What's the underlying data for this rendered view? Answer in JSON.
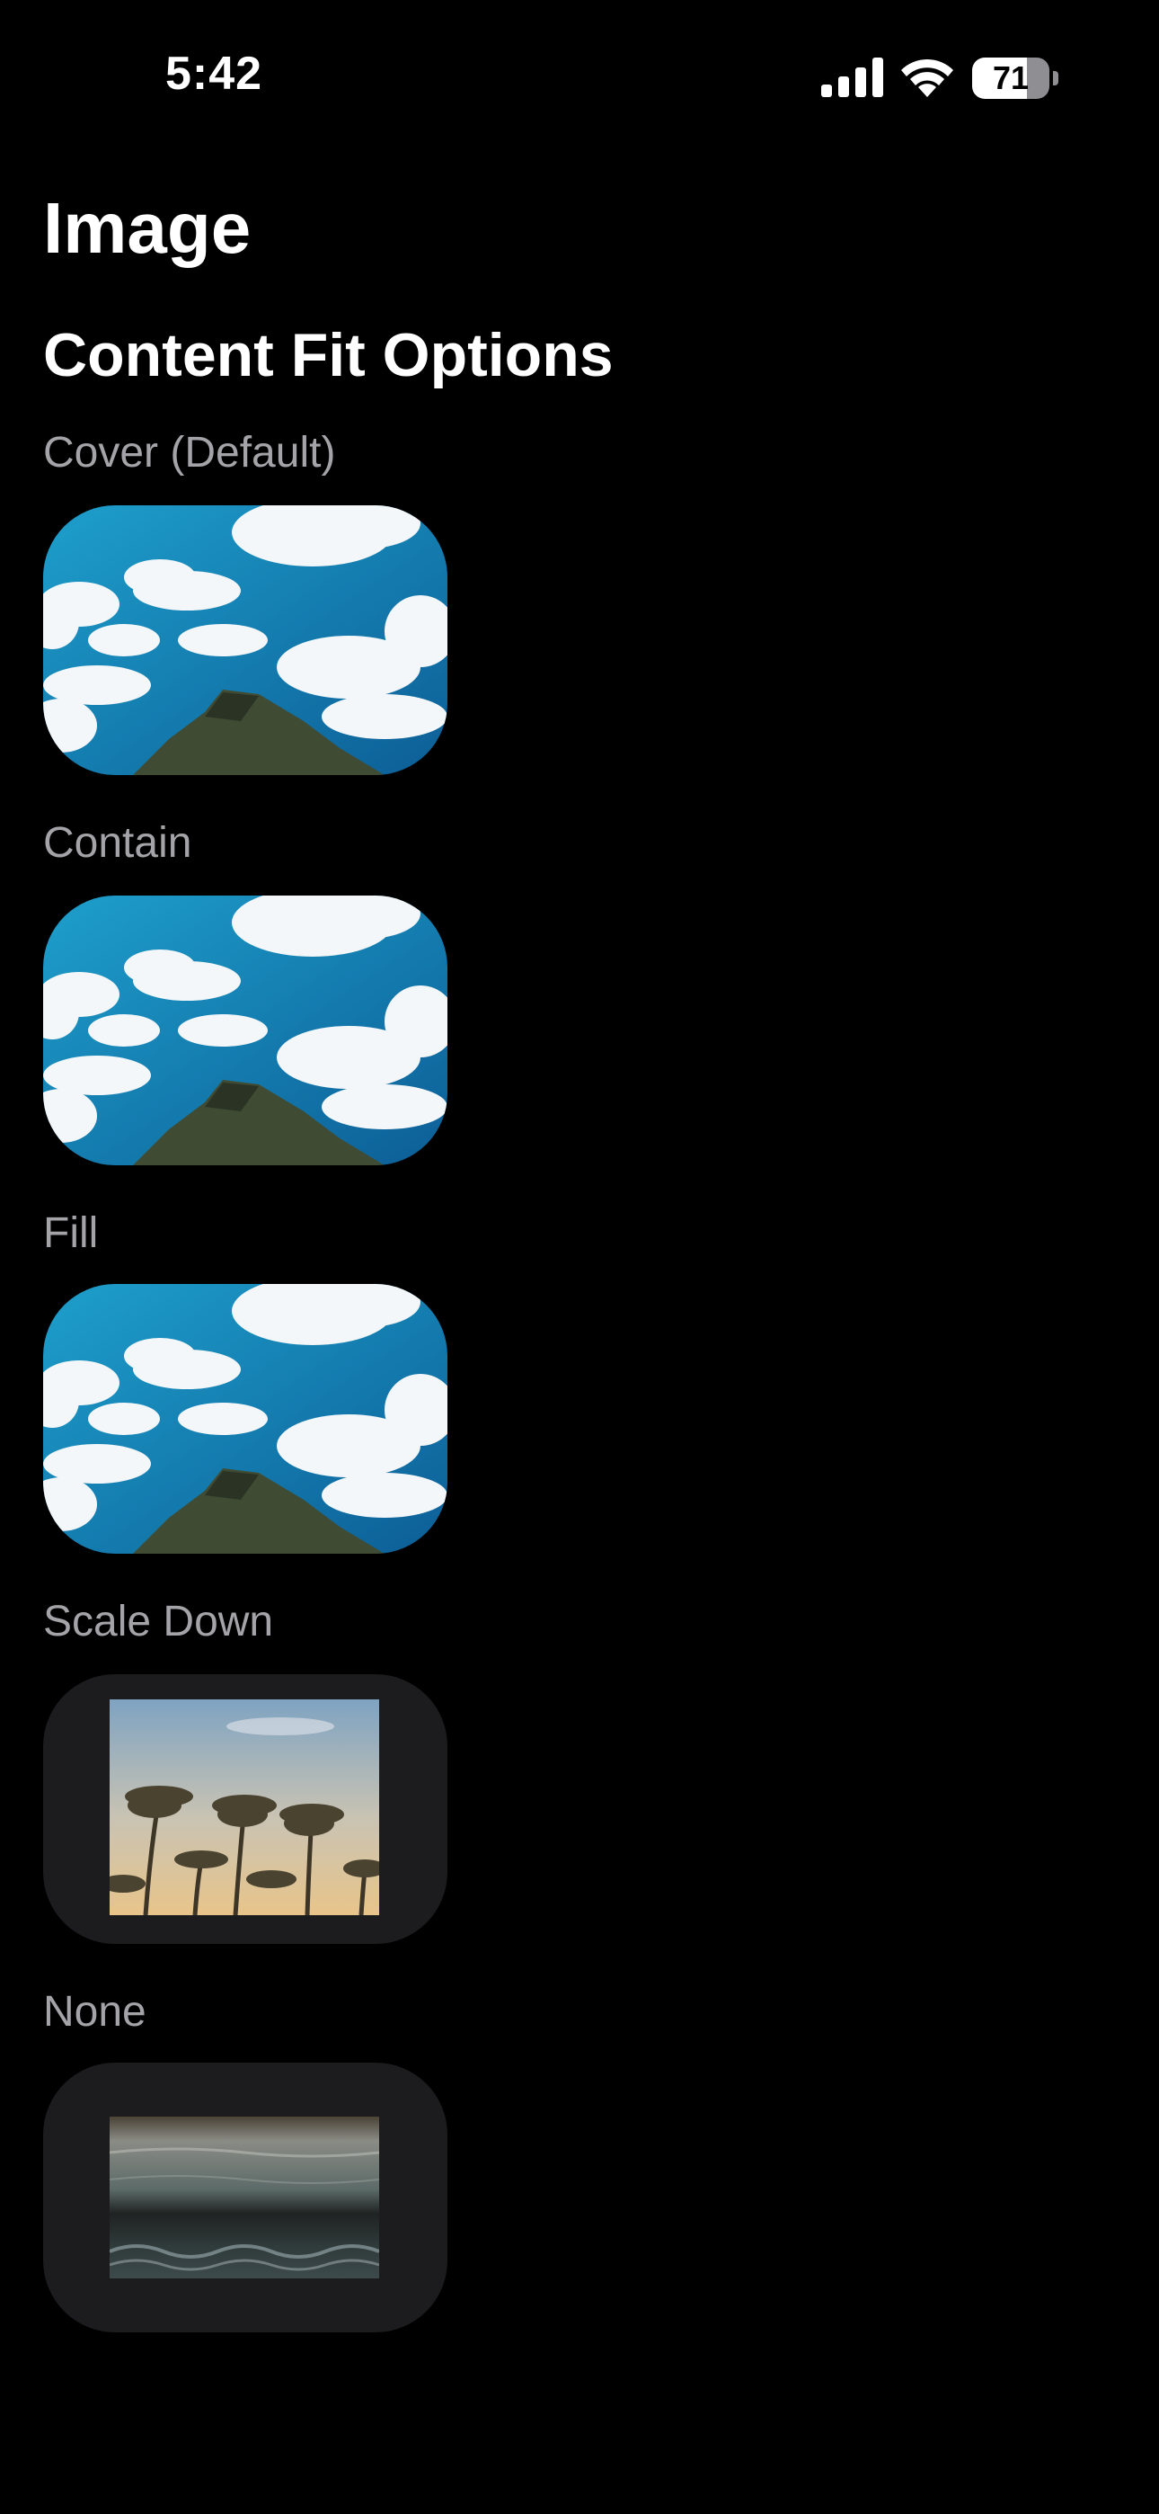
{
  "status_bar": {
    "time": "5:42",
    "battery_level": "71",
    "battery_percent": 71,
    "icons": [
      "signal-icon",
      "wifi-icon",
      "battery-icon"
    ]
  },
  "header": {
    "title": "Image"
  },
  "section": {
    "title": "Content Fit Options",
    "options": [
      {
        "label": "Cover (Default)",
        "image": "cloudy-sky-mountain-peak"
      },
      {
        "label": "Contain",
        "image": "cloudy-sky-mountain-peak"
      },
      {
        "label": "Fill",
        "image": "cloudy-sky-mountain-peak"
      },
      {
        "label": "Scale Down",
        "image": "palm-trees-sunset"
      },
      {
        "label": "None",
        "image": "ocean-waves"
      }
    ]
  },
  "colors": {
    "background": "#000000",
    "label": "#a3a3a8",
    "tile_background": "#1c1c1e"
  }
}
